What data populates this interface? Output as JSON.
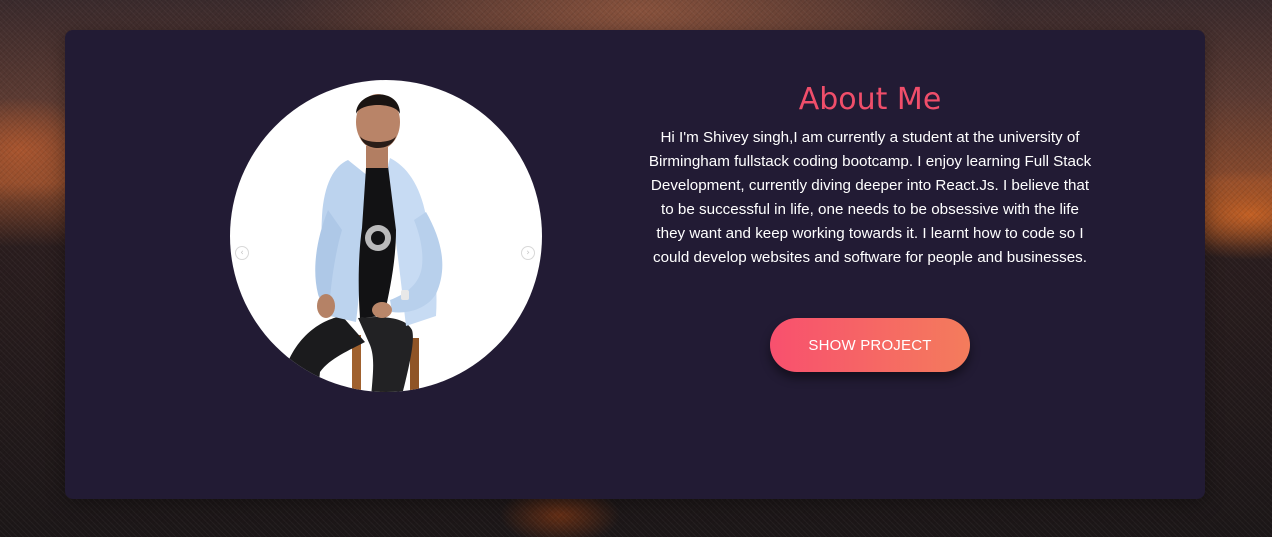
{
  "about": {
    "title": "About Me",
    "description": "Hi I'm Shivey singh,I am currently a student at the university of Birmingham fullstack coding bootcamp. I enjoy learning Full Stack Development, currently diving deeper into React.Js. I believe that to be successful in life, one needs to be obsessive with the life they want and keep working towards it. I learnt how to code so I could develop websites and software for people and businesses."
  },
  "button": {
    "label": "SHOW PROJECT"
  },
  "carousel": {
    "prev_icon": "chevron-left-icon",
    "next_icon": "chevron-right-icon"
  },
  "colors": {
    "card_bg": "#221b34",
    "title": "#f04e6a",
    "button_start": "#f8506e",
    "button_end": "#f47c5c"
  }
}
